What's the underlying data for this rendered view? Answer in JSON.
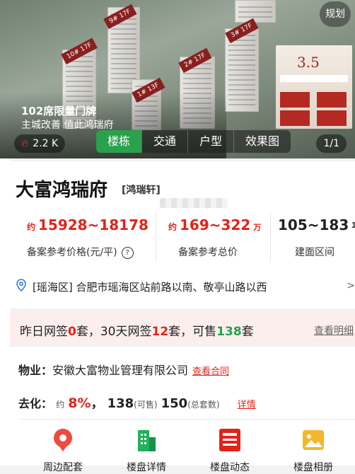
{
  "hero": {
    "plan_label": "规划",
    "building_tags": [
      "9# 17F",
      "10# 17F",
      "1# 13F",
      "2# 17F",
      "3# 17F"
    ],
    "ad_title": "102席限量门牌",
    "ad_subtitle": "主城改善 值此鸿瑞府",
    "views": "2.2 K",
    "tabs": [
      "楼栋",
      "交通",
      "户型",
      "效果图"
    ],
    "counter": "1/1",
    "poster_text": "3.5"
  },
  "project": {
    "name": "大富鸿瑞府",
    "alias": "[鸿瑞轩]"
  },
  "stats": {
    "price": {
      "prefix": "约",
      "value": "15928~18178",
      "caption": "备案参考价格(元/平)"
    },
    "total": {
      "prefix": "约",
      "value": "169~322",
      "unit": "万",
      "caption": "备案参考总价"
    },
    "area": {
      "value": "105~183",
      "unit": "平",
      "caption": "建面区间"
    }
  },
  "address": "[瑶海区] 合肥市瑶海区站前路以南、敬亭山路以西",
  "address_arrow": ">",
  "sales": {
    "t1": "昨日网签",
    "n1": "0",
    "t2": "套，30天网签",
    "n2": "12",
    "t3": "套，可售",
    "n3": "138",
    "t4": "套",
    "link": "查看明细"
  },
  "property": {
    "label": "物业：",
    "value": "安徽大富物业管理有限公司",
    "link": "查看合同"
  },
  "destock": {
    "label": "去化：",
    "approx": "约",
    "pct": "8%",
    "sep": "，",
    "available": "138",
    "available_note": "(可售)",
    "total": "150",
    "total_note": "(总套数)",
    "link": "详情"
  },
  "shortcuts": [
    {
      "icon": "location-pin-icon",
      "label": "周边配套"
    },
    {
      "icon": "building-icon",
      "label": "楼盘详情"
    },
    {
      "icon": "news-icon",
      "label": "楼盘动态"
    },
    {
      "icon": "photo-icon",
      "label": "楼盘相册"
    }
  ],
  "colors": {
    "accent_red": "#e2231a",
    "active_tab_green": "#2aa14b",
    "sale_green": "#22a34a"
  }
}
